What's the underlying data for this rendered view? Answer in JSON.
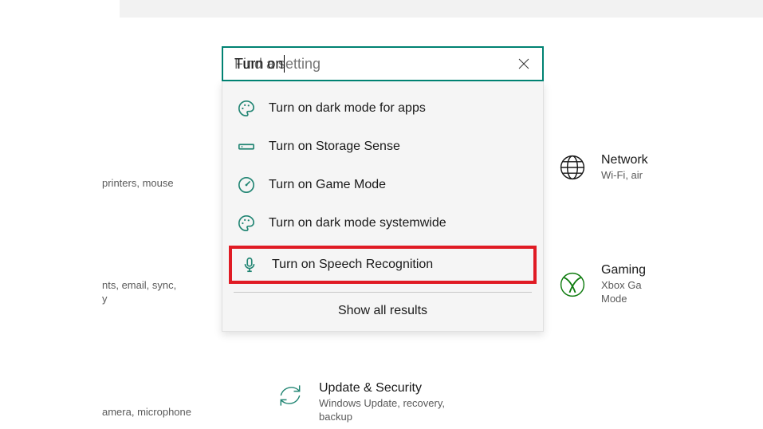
{
  "search": {
    "value": "Turn on",
    "placeholder": "Find a setting"
  },
  "results": [
    {
      "icon": "palette-icon",
      "label": "Turn on dark mode for apps"
    },
    {
      "icon": "storage-icon",
      "label": "Turn on Storage Sense"
    },
    {
      "icon": "gauge-icon",
      "label": "Turn on Game Mode"
    },
    {
      "icon": "palette-icon",
      "label": "Turn on dark mode systemwide"
    },
    {
      "icon": "mic-icon",
      "label": "Turn on Speech Recognition",
      "highlighted": true
    }
  ],
  "show_all_label": "Show all results",
  "bg_fragments": {
    "devices_sub": "printers, mouse",
    "accounts_sub_a": "nts, email, sync,",
    "accounts_sub_b": "y",
    "privacy_sub": "amera, microphone"
  },
  "tiles": {
    "network": {
      "title": "Network",
      "sub": "Wi-Fi, air"
    },
    "gaming": {
      "title": "Gaming",
      "sub_a": "Xbox Ga",
      "sub_b": "Mode"
    },
    "update": {
      "title": "Update & Security",
      "sub_a": "Windows Update, recovery,",
      "sub_b": "backup"
    }
  }
}
